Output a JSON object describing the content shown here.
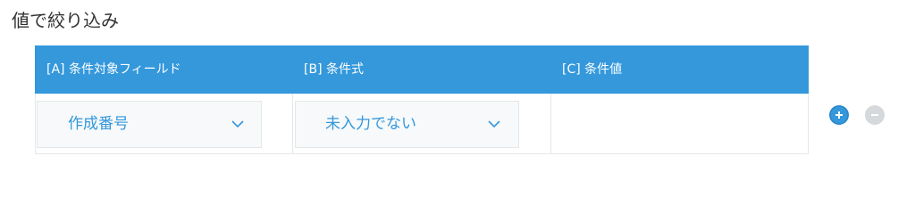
{
  "section": {
    "title": "値で絞り込み"
  },
  "table": {
    "columns": [
      {
        "label": "[A] 条件対象フィールド"
      },
      {
        "label": "[B] 条件式"
      },
      {
        "label": "[C] 条件値"
      }
    ],
    "row": {
      "field_select": {
        "value": "作成番号",
        "icon": "chevron-down-icon"
      },
      "condition_select": {
        "value": "未入力でない",
        "icon": "chevron-down-icon"
      },
      "condition_value": ""
    }
  },
  "actions": {
    "add_icon": "plus-icon",
    "remove_icon": "minus-icon"
  },
  "colors": {
    "accent": "#3498db",
    "header_text": "#ffffff",
    "disabled_button": "#cfd4d6"
  }
}
